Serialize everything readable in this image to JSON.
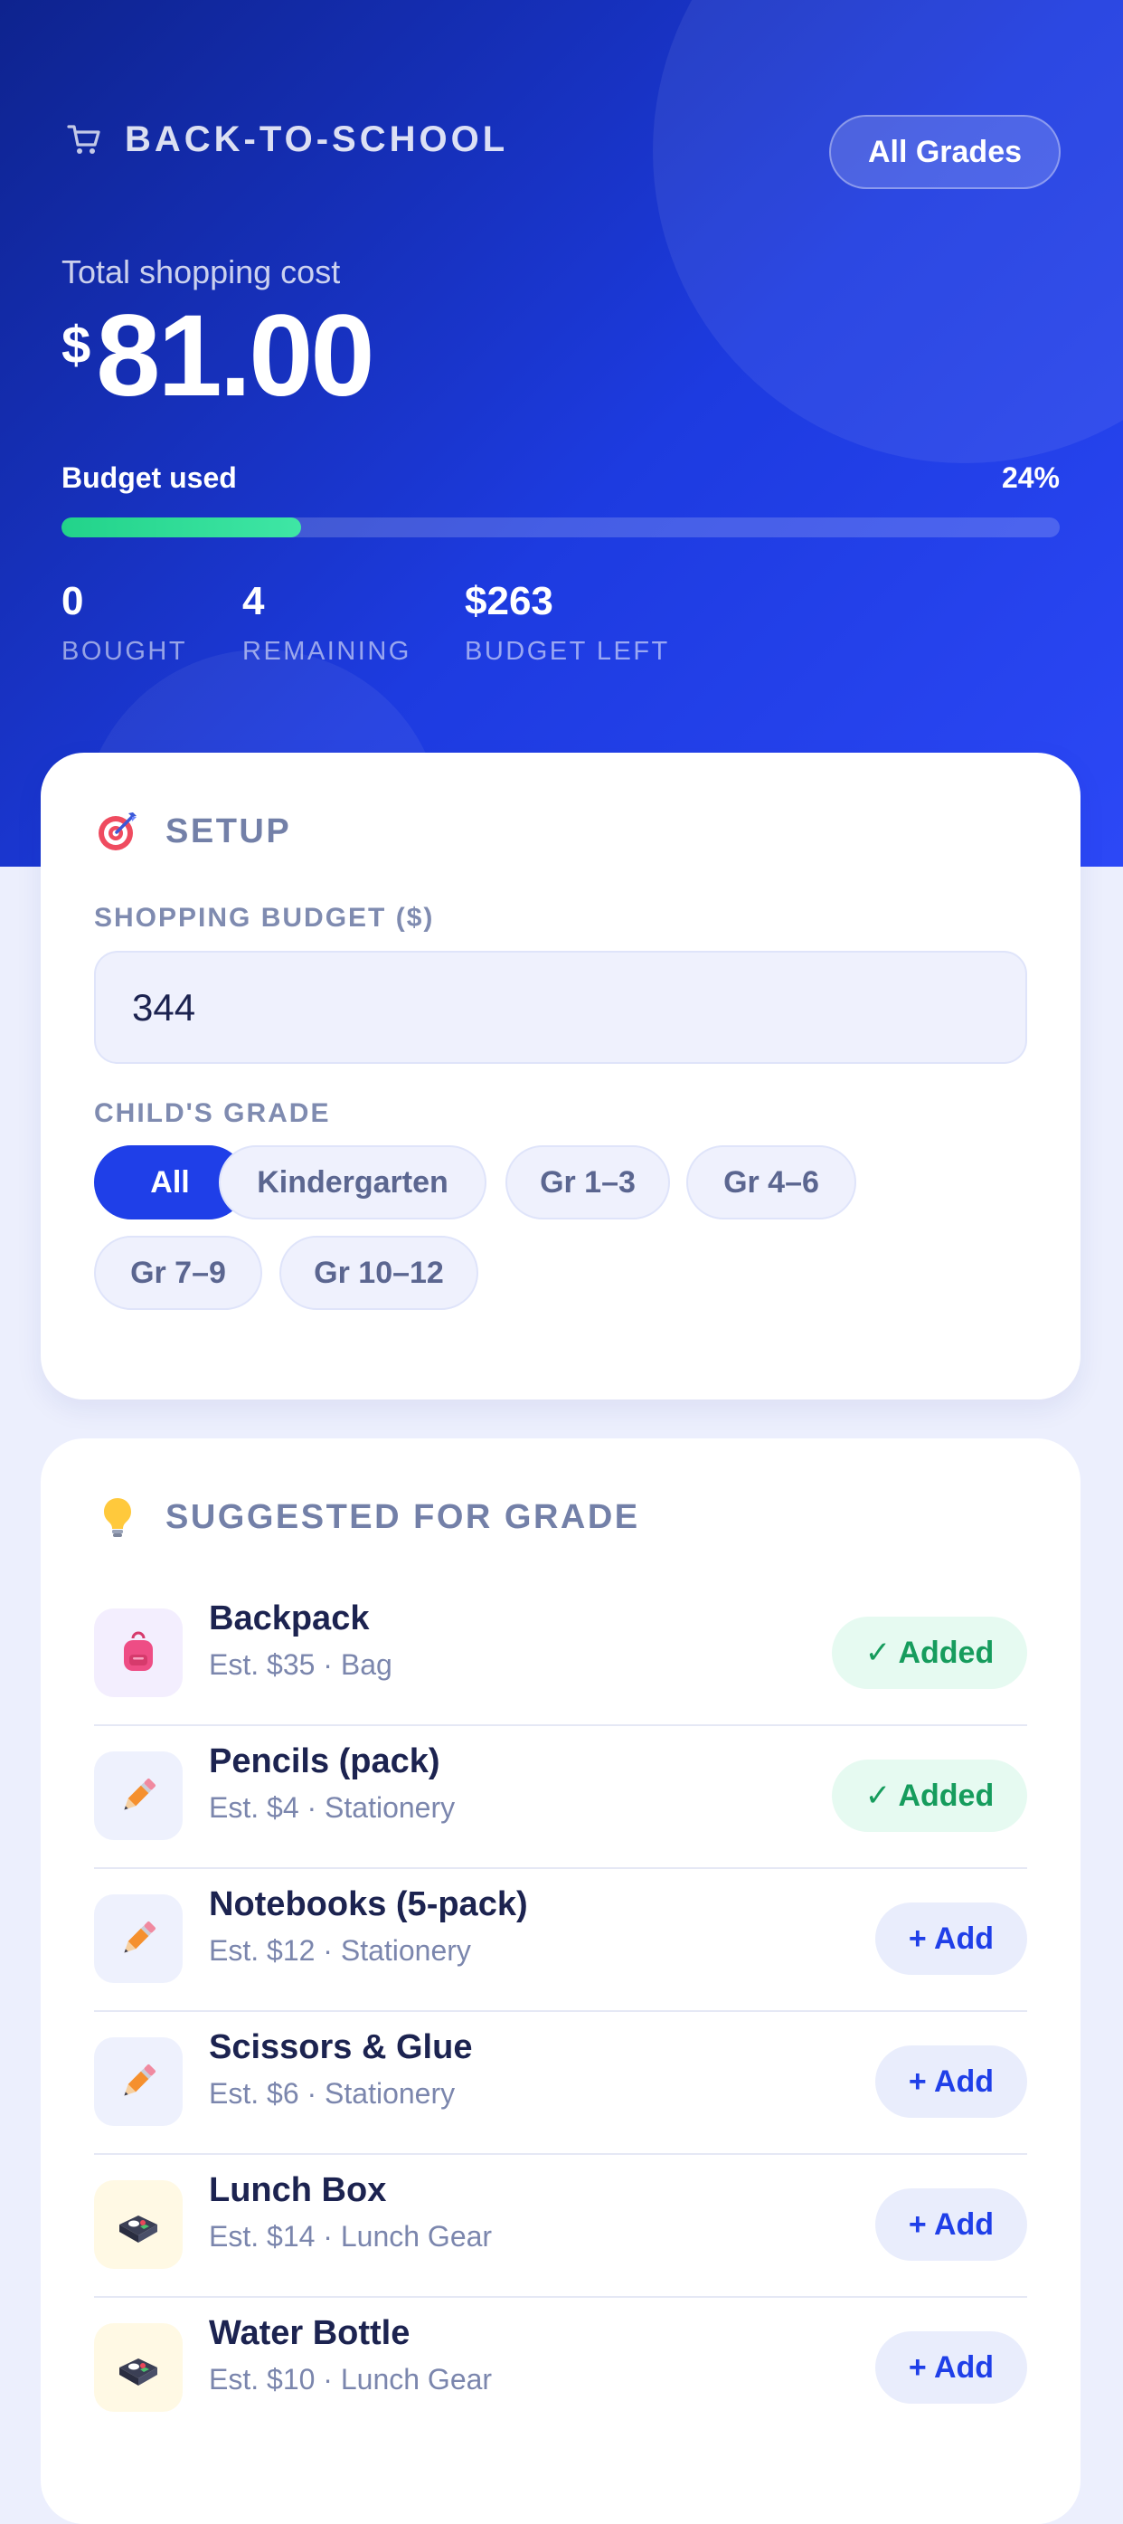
{
  "header": {
    "title": "BACK-TO-SCHOOL",
    "grade_button": "All Grades",
    "total_label": "Total shopping cost",
    "currency": "$",
    "total_amount": "81.00",
    "budget_used_label": "Budget used",
    "budget_used_percent_text": "24%",
    "budget_used_fraction": 0.24,
    "stats": [
      {
        "value": "0",
        "label": "BOUGHT"
      },
      {
        "value": "4",
        "label": "REMAINING"
      },
      {
        "value": "$263",
        "label": "BUDGET LEFT"
      }
    ]
  },
  "setup": {
    "title": "SETUP",
    "budget_label": "SHOPPING BUDGET ($)",
    "budget_value": "344",
    "grade_label": "CHILD'S GRADE",
    "grades": [
      "All",
      "Kindergarten",
      "Gr 1–3",
      "Gr 4–6",
      "Gr 7–9",
      "Gr 10–12"
    ],
    "selected_grade": "All"
  },
  "suggested": {
    "title": "SUGGESTED FOR GRADE",
    "items": [
      {
        "name": "Backpack",
        "meta": "Est. $35 · Bag",
        "action": "✓ Added",
        "icon": "backpack-icon"
      },
      {
        "name": "Pencils (pack)",
        "meta": "Est. $4 · Stationery",
        "action": "✓ Added",
        "icon": "pencil-icon"
      },
      {
        "name": "Notebooks (5-pack)",
        "meta": "Est. $12 · Stationery",
        "action": "+ Add",
        "icon": "pencil-icon"
      },
      {
        "name": "Scissors & Glue",
        "meta": "Est. $6 · Stationery",
        "action": "+ Add",
        "icon": "pencil-icon"
      },
      {
        "name": "Lunch Box",
        "meta": "Est. $14 · Lunch Gear",
        "action": "+ Add",
        "icon": "bento-box-icon"
      },
      {
        "name": "Water Bottle",
        "meta": "Est. $10 · Lunch Gear",
        "action": "+ Add",
        "icon": "bento-box-icon"
      }
    ]
  },
  "colors": {
    "primary": "#1f3fe8",
    "hero_dark": "#0e238e",
    "progress": "#22d38a",
    "added_green": "#169c5d"
  }
}
